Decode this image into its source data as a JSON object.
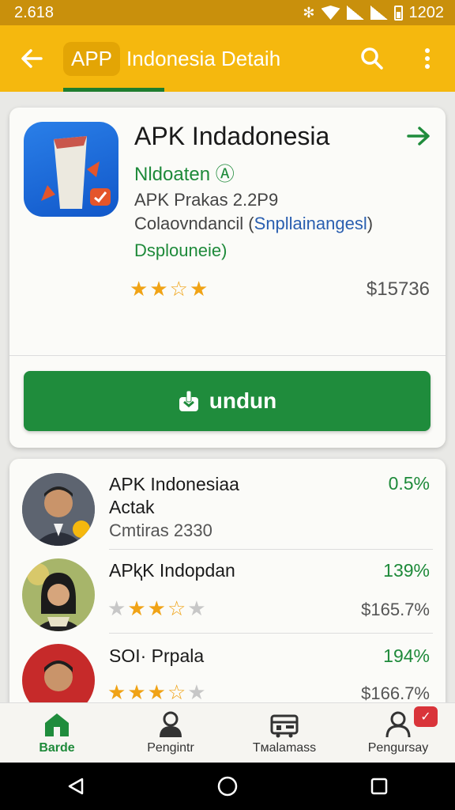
{
  "status_bar": {
    "time": "2.618",
    "right_time": "1202"
  },
  "app_bar": {
    "pill": "APP",
    "title": "Indonesia Detaih"
  },
  "app": {
    "name": "APK Indadonesia",
    "developer": "Nldoaten",
    "version": "APK Prakas 2.2P9",
    "category_prefix": "Colaovndancil (",
    "category_highlight": "Snpllainangesl",
    "category_suffix": ")",
    "status": "Dsplouneie)",
    "rating": 3,
    "price": "$15736",
    "download_label": "undun",
    "colors": {
      "accent": "#f5b80e",
      "green": "#1f8c3c"
    }
  },
  "list": [
    {
      "title": "APK Indonesiaa\nActak",
      "subtitle": "Cmtiras 2330",
      "percent": "0.5%"
    },
    {
      "title": "APⱪK Indopdan",
      "percent": "139%",
      "rating": 3,
      "price": "$165.7%"
    },
    {
      "title": "SOI· Prpala",
      "percent": "194%",
      "rating": 3.5,
      "price": "$166.7%"
    }
  ],
  "bottom_nav": [
    {
      "label": "Barde",
      "icon": "home-icon"
    },
    {
      "label": "Pengintr",
      "icon": "person-icon"
    },
    {
      "label": "Tмalamass",
      "icon": "store-icon"
    },
    {
      "label": "Pengursay",
      "icon": "profile-icon"
    }
  ]
}
